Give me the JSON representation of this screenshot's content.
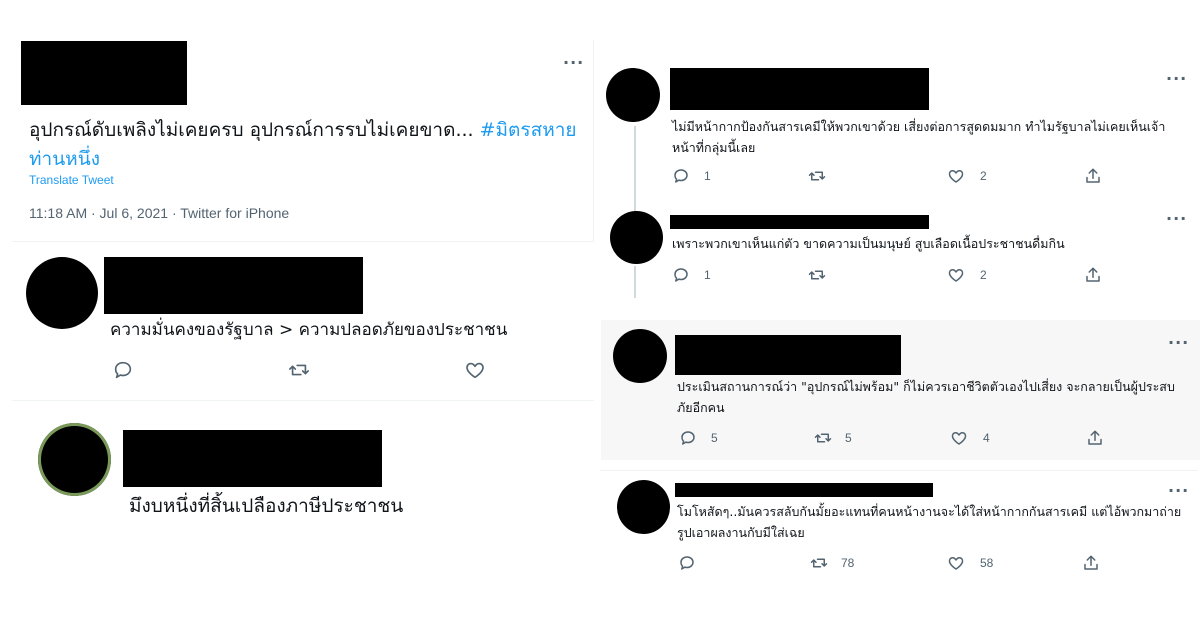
{
  "main_tweet": {
    "text": "อุปกรณ์ดับเพลิงไม่เคยครบ อุปกรณ์การรบไม่เคยขาด...",
    "hashtag": "#มิตรสหายท่านหนึ่ง",
    "translate": "Translate Tweet",
    "meta": "11:18 AM · Jul 6, 2021 · Twitter for iPhone",
    "more": "···"
  },
  "left_replies": [
    {
      "text": "ความมั่นคงของรัฐบาล > ความปลอดภัยของประชาชน"
    },
    {
      "text": "มึงบหนึ่งที่สิ้นเปลืองภาษีประชาชน"
    }
  ],
  "right_replies": [
    {
      "text": "ไม่มีหน้ากากป้องกันสารเคมีให้พวกเขาด้วย เสี่ยงต่อการสูดดมมาก ทำไมรัฐบาลไม่เคยเห็นเจ้าหน้าที่กลุ่มนี้เลย",
      "reply_count": "1",
      "retweet_count": "",
      "like_count": "2"
    },
    {
      "text": "เพราะพวกเขาเห็นแก่ตัว ขาดความเป็นมนุษย์ สูบเลือดเนื้อประชาชนดื่มกิน",
      "reply_count": "1",
      "retweet_count": "",
      "like_count": "2"
    },
    {
      "text": "ประเมินสถานการณ์ว่า \"อุปกรณ์ไม่พร้อม\" ก็ไม่ควรเอาชีวิตตัวเองไปเสี่ยง จะกลายเป็นผู้ประสบภัยอีกคน",
      "reply_count": "5",
      "retweet_count": "5",
      "like_count": "4"
    },
    {
      "text": "โมโหสัดๆ..มันควรสลับกันมั้ยอะแทนที่คนหน้างานจะได้ใส่หน้ากากกันสารเคมี แต่ไอ้พวกมาถ่ายรูปเอาผลงานกับมีใส่เฉย",
      "reply_count": "",
      "retweet_count": "78",
      "like_count": "58"
    }
  ],
  "icons": [
    "reply-icon",
    "retweet-icon",
    "like-icon",
    "share-icon",
    "more-icon"
  ],
  "colors": {
    "link": "#1d9bf0",
    "muted": "#536471",
    "border": "#eff3f4",
    "highlight_bg": "#f7f7f7"
  }
}
